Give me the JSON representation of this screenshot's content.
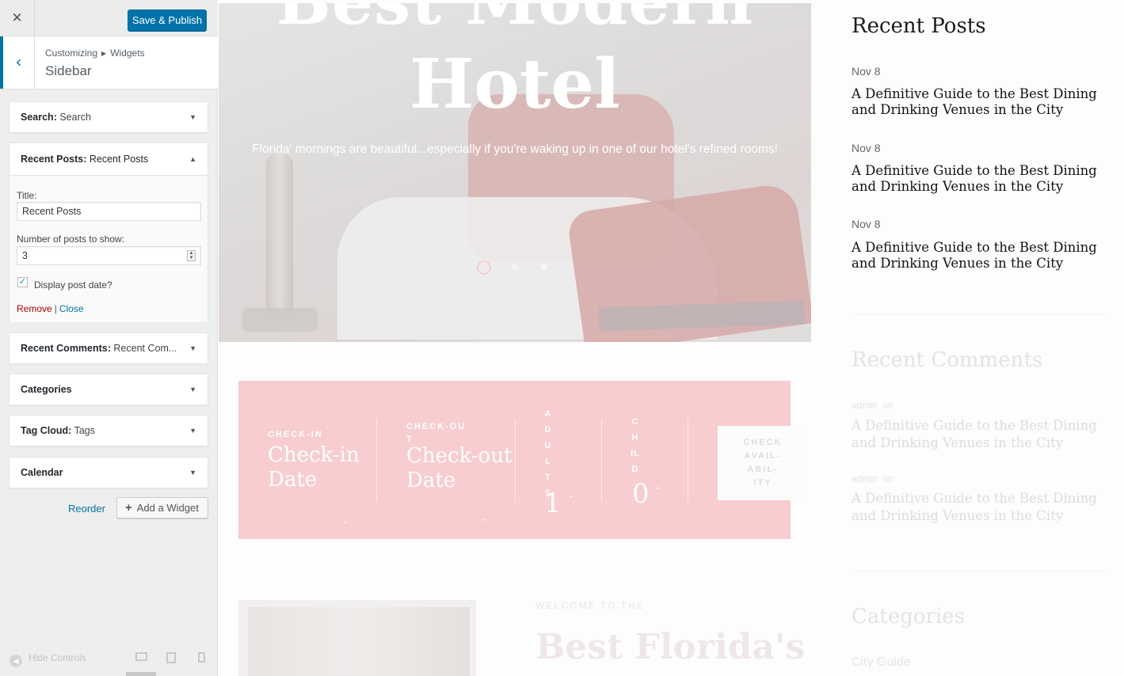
{
  "customizer": {
    "close_icon": "close-icon",
    "save_label": "Save & Publish",
    "breadcrumb": [
      "Customizing",
      "Widgets"
    ],
    "section_title": "Sidebar",
    "widgets": {
      "search": {
        "type": "Search:",
        "title": "Search"
      },
      "recent_posts": {
        "type": "Recent Posts:",
        "title": "Recent Posts",
        "title_label": "Title:",
        "title_value": "Recent Posts",
        "number_label": "Number of posts to show:",
        "number_value": "3",
        "display_date_label": "Display post date?",
        "display_date_checked": true,
        "remove_label": "Remove",
        "separator": "|",
        "close_label": "Close"
      },
      "recent_comments": {
        "type": "Recent Comments:",
        "title": "Recent Com..."
      },
      "categories": {
        "type": "Categories",
        "title": ""
      },
      "tag_cloud": {
        "type": "Tag Cloud:",
        "title": "Tags"
      },
      "calendar": {
        "type": "Calendar",
        "title": ""
      }
    },
    "reorder_label": "Reorder",
    "add_widget_label": "Add a Widget",
    "hide_controls_label": "Hide Controls"
  },
  "preview": {
    "hero": {
      "title_line1": "Best Modern",
      "title_line2": "Hotel",
      "subtitle": "Florida' mornings are beautiful...especially if you're waking up in one of our hotel's refined rooms!",
      "slides": 3
    },
    "booking": {
      "checkin_label": "CHECK-IN",
      "checkin_value_1": "Check-in",
      "checkin_value_2": "Date",
      "checkout_label_1": "CHECK-OU",
      "checkout_label_2": "T",
      "checkout_value_1": "Check-out",
      "checkout_value_2": "Date",
      "adults_label": "ADULTS",
      "adults_value": "1",
      "child_label": "CHILD",
      "child_value": "0",
      "button_lines": [
        "CHECK",
        "AVAIL-",
        "ABIL-",
        "ITY"
      ]
    },
    "welcome_label": "WELCOME TO THE",
    "lower_title": "Best Florida's",
    "recent_posts": {
      "title": "Recent Posts",
      "posts": [
        {
          "date": "Nov 8",
          "title": "A Definitive Guide to the Best Dining and Drinking Venues in the City"
        },
        {
          "date": "Nov 8",
          "title": "A Definitive Guide to the Best Dining and Drinking Venues in the City"
        },
        {
          "date": "Nov 8",
          "title": "A Definitive Guide to the Best Dining and Drinking Venues in the City"
        }
      ]
    },
    "recent_comments": {
      "title": "Recent Comments",
      "items": [
        {
          "author": "admin",
          "on": "on",
          "title": "A Definitive Guide to the Best Dining and Drinking Venues in the City"
        },
        {
          "author": "admin",
          "on": "on",
          "title": "A Definitive Guide to the Best Dining and Drinking Venues in the City"
        }
      ]
    },
    "categories": {
      "title": "Categories",
      "first_item": "City Guide"
    }
  },
  "colors": {
    "accent": "#0073aa",
    "remove": "#aa0000",
    "booking_bg": "#f7cdd0"
  }
}
